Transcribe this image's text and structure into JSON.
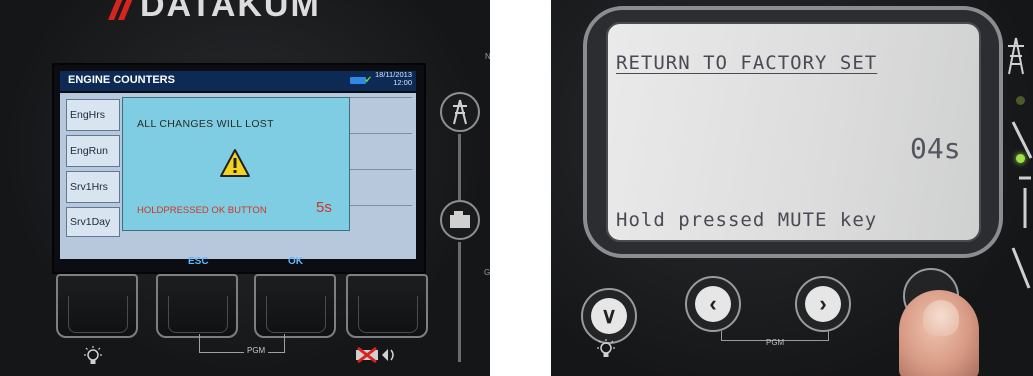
{
  "left_photo": {
    "brand": "DATAKUM",
    "screen": {
      "title": "ENGINE COUNTERS",
      "date": "18/11/2013",
      "time": "12:00",
      "list_items": [
        "EngHrs",
        "EngRun",
        "Srv1Hrs",
        "Srv1Day"
      ],
      "popup": {
        "message": "ALL CHANGES WILL LOST",
        "hold_text": "HOLDPRESSED OK BUTTON",
        "seconds": "5s"
      },
      "softkeys": {
        "left": "ESC",
        "right": "OK"
      }
    },
    "pgm_label": "PGM",
    "colors": {
      "header": "#0d2a55",
      "popup_bg": "#7ecde2",
      "warning_red": "#d33425",
      "softkey_blue": "#62b7ff"
    },
    "icons": [
      "warning-icon",
      "bulb-icon",
      "mute-icon",
      "tower-icon",
      "generator-icon",
      "datakom-logo-icon"
    ]
  },
  "right_photo": {
    "screen": {
      "title": "RETURN TO FACTORY SET",
      "countdown": "04s",
      "hint": "Hold pressed MUTE key"
    },
    "pgm_label": "PGM",
    "icons": [
      "down-arrow-icon",
      "left-arrow-icon",
      "right-arrow-icon",
      "bulb-icon",
      "tower-icon"
    ]
  }
}
